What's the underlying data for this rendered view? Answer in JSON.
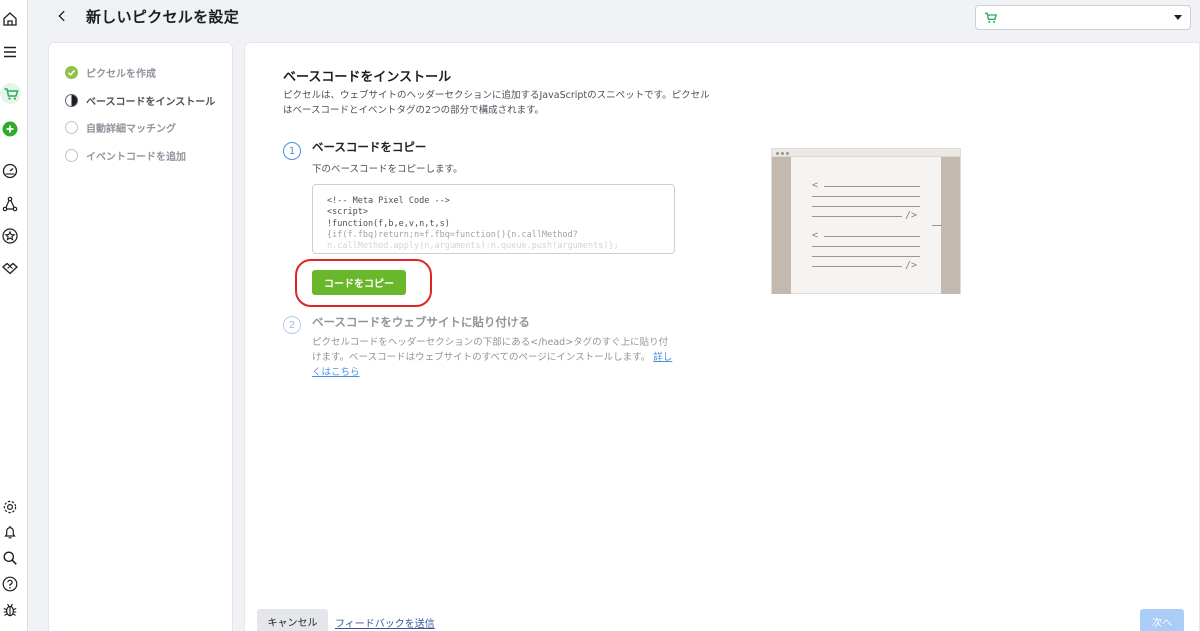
{
  "header": {
    "title": "新しいピクセルを設定",
    "account_select_value": ""
  },
  "steps": [
    {
      "label": "ピクセルを作成",
      "state": "done"
    },
    {
      "label": "ベースコードをインストール",
      "state": "current"
    },
    {
      "label": "自動詳細マッチング",
      "state": "todo"
    },
    {
      "label": "イベントコードを追加",
      "state": "todo"
    }
  ],
  "main": {
    "title": "ベースコードをインストール",
    "description": "ピクセルは、ウェブサイトのヘッダーセクションに追加するJavaScriptのスニペットです。ピクセルはベースコードとイベントタグの2つの部分で構成されます。",
    "step1": {
      "number": "1",
      "title": "ベースコードをコピー",
      "description": "下のベースコードをコピーします。",
      "code_lines": [
        "<!-- Meta Pixel Code -->",
        "<script>",
        "!function(f,b,e,v,n,t,s)",
        "{if(f.fbq)return;n=f.fbq=function(){n.callMethod?",
        "n.callMethod.apply(n,arguments):n.queue.push(arguments)};"
      ],
      "copy_button": "コードをコピー"
    },
    "step2": {
      "number": "2",
      "title": "ベースコードをウェブサイトに貼り付ける",
      "description": "ピクセルコードをヘッダーセクションの下部にある</head>タグのすぐ上に貼り付けます。ベースコードはウェブサイトのすべてのページにインストールします。",
      "link": "詳しくはこちら"
    }
  },
  "footer": {
    "cancel": "キャンセル",
    "feedback": "フィードバックを送信",
    "next": "次へ"
  },
  "colors": {
    "accent_green": "#69b82c",
    "highlight_red": "#e02424",
    "link_blue": "#4a90e2",
    "next_disabled": "#a9cdf7"
  },
  "icons": [
    "home-icon",
    "menu-icon",
    "shop-icon",
    "add-icon",
    "dashboard-icon",
    "graph-icon",
    "star-icon",
    "handshake-icon",
    "settings-icon",
    "bell-icon",
    "search-icon",
    "help-icon",
    "bug-icon"
  ]
}
